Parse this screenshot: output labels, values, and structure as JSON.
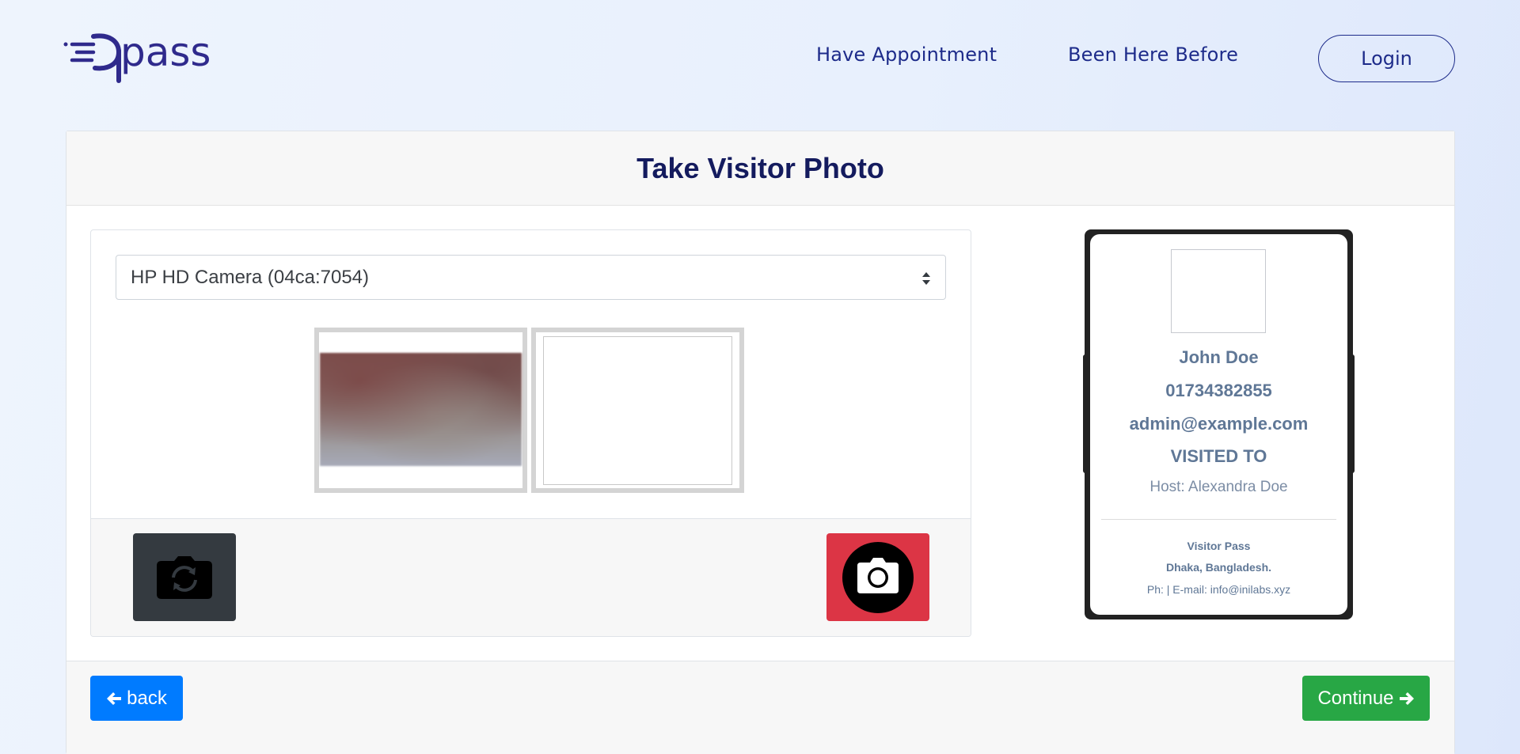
{
  "header": {
    "logo_text": "pass",
    "nav": {
      "have_appointment": "Have Appointment",
      "been_here_before": "Been Here Before"
    },
    "login_label": "Login"
  },
  "card": {
    "title": "Take Visitor Photo"
  },
  "camera": {
    "selected_device": "HP HD Camera (04ca:7054)",
    "switch_icon": "camera-switch-icon",
    "capture_icon": "camera-icon"
  },
  "visitor_pass": {
    "name": "John Doe",
    "phone": "01734382855",
    "email": "admin@example.com",
    "visited_to": "VISITED TO",
    "host": "Host: Alexandra Doe",
    "company": "Visitor Pass",
    "address": "Dhaka, Bangladesh.",
    "contact": "Ph: | E-mail: info@inilabs.xyz"
  },
  "footer": {
    "back_label": "back",
    "back_icon": "arrow-left-icon",
    "continue_label": "Continue",
    "continue_icon": "arrow-right-icon"
  },
  "colors": {
    "brand": "#2f2a8c",
    "nav_text": "#1d2b8a",
    "title": "#141b5e",
    "back_button": "#007bff",
    "continue_button": "#28a745",
    "capture_button": "#dc3545",
    "switch_button": "#343a40"
  }
}
